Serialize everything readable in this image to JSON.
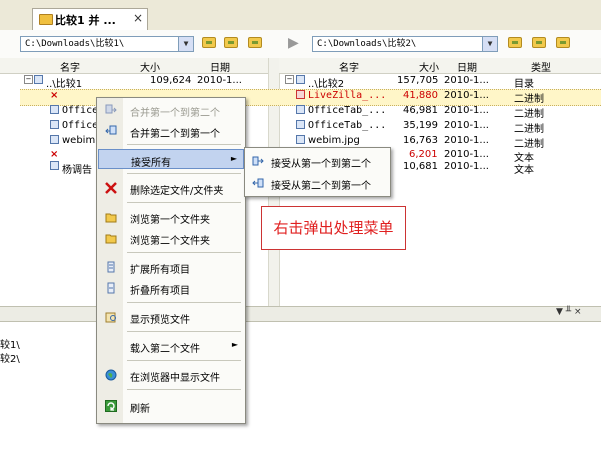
{
  "tab": {
    "label": "比较1 并 ...",
    "close": "×"
  },
  "left": {
    "path": "C:\\Downloads\\比较1\\",
    "columns": {
      "name": "名字",
      "size": "大小",
      "date": "日期"
    },
    "rows": [
      {
        "name": "..\\比较1",
        "size": "109,624",
        "date": "2010-1..."
      },
      {
        "name": "×",
        "size": "",
        "date": ""
      },
      {
        "name": "OfficeT",
        "size": "",
        "date": ""
      },
      {
        "name": "OfficeT",
        "size": "",
        "date": ""
      },
      {
        "name": "webim.j",
        "size": "",
        "date": ""
      },
      {
        "name": "×",
        "size": "",
        "date": ""
      },
      {
        "name": "杨调告 i",
        "size": "",
        "date": ""
      }
    ]
  },
  "right": {
    "path": "C:\\Downloads\\比较2\\",
    "columns": {
      "name": "名字",
      "size": "大小",
      "date": "日期",
      "type": "类型"
    },
    "rows": [
      {
        "name": "..\\比较2",
        "size": "157,705",
        "date": "2010-1...",
        "type": "目录"
      },
      {
        "name": "LiveZilla_...",
        "size": "41,880",
        "date": "2010-1...",
        "type": "二进制"
      },
      {
        "name": "OfficeTab_...",
        "size": "46,981",
        "date": "2010-1...",
        "type": "二进制"
      },
      {
        "name": "OfficeTab_...",
        "size": "35,199",
        "date": "2010-1...",
        "type": "二进制"
      },
      {
        "name": "webim.jpg",
        "size": "16,763",
        "date": "2010-1...",
        "type": "二进制"
      },
      {
        "name": "",
        "size": "6,201",
        "date": "2010-1...",
        "type": "文本"
      },
      {
        "name": "",
        "size": "10,681",
        "date": "2010-1...",
        "type": "文本"
      }
    ]
  },
  "context_menu": {
    "items": [
      {
        "label": "合并第一个到第二个"
      },
      {
        "label": "合并第二个到第一个"
      },
      {
        "label": "接受所有"
      },
      {
        "label": "删除选定文件/文件夹"
      },
      {
        "label": "浏览第一个文件夹"
      },
      {
        "label": "浏览第二个文件夹"
      },
      {
        "label": "扩展所有项目"
      },
      {
        "label": "折叠所有项目"
      },
      {
        "label": "显示预览文件"
      },
      {
        "label": "载入第二个文件"
      },
      {
        "label": "在浏览器中显示文件"
      },
      {
        "label": "刷新"
      }
    ],
    "submenu_arrow": "►"
  },
  "submenu": {
    "items": [
      {
        "label": "接受从第一个到第二个"
      },
      {
        "label": "接受从第二个到第一个"
      }
    ]
  },
  "annotation": "右击弹出处理菜单",
  "bottom": {
    "controls": "▼ ╨ ×",
    "log_lines": [
      "较1\\",
      "较2\\"
    ]
  },
  "colors": {
    "highlight": "#c2d3ef",
    "annotation": "#e02020",
    "diff_red": "#cc0000"
  }
}
